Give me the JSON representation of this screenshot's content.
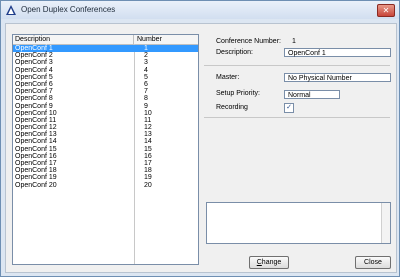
{
  "window": {
    "title": "Open Duplex Conferences",
    "close_glyph": "✕"
  },
  "list": {
    "columns": {
      "description": "Description",
      "number": "Number"
    },
    "rows": [
      {
        "description": "OpenConf 1",
        "number": "1"
      },
      {
        "description": "OpenConf 2",
        "number": "2"
      },
      {
        "description": "OpenConf 3",
        "number": "3"
      },
      {
        "description": "OpenConf 4",
        "number": "4"
      },
      {
        "description": "OpenConf 5",
        "number": "5"
      },
      {
        "description": "OpenConf 6",
        "number": "6"
      },
      {
        "description": "OpenConf 7",
        "number": "7"
      },
      {
        "description": "OpenConf 8",
        "number": "8"
      },
      {
        "description": "OpenConf 9",
        "number": "9"
      },
      {
        "description": "OpenConf 10",
        "number": "10"
      },
      {
        "description": "OpenConf 11",
        "number": "11"
      },
      {
        "description": "OpenConf 12",
        "number": "12"
      },
      {
        "description": "OpenConf 13",
        "number": "13"
      },
      {
        "description": "OpenConf 14",
        "number": "14"
      },
      {
        "description": "OpenConf 15",
        "number": "15"
      },
      {
        "description": "OpenConf 16",
        "number": "16"
      },
      {
        "description": "OpenConf 17",
        "number": "17"
      },
      {
        "description": "OpenConf 18",
        "number": "18"
      },
      {
        "description": "OpenConf 19",
        "number": "19"
      },
      {
        "description": "OpenConf 20",
        "number": "20"
      }
    ],
    "selected_index": 0
  },
  "details": {
    "conference_number_label": "Conference Number:",
    "conference_number_value": "1",
    "description_label": "Description:",
    "description_value": "OpenConf 1",
    "master_label": "Master:",
    "master_value": "No Physical Number",
    "setup_priority_label": "Setup Priority:",
    "setup_priority_value": "Normal",
    "recording_label": "Recording",
    "recording_checked": true,
    "check_glyph": "✓"
  },
  "buttons": {
    "change_first": "C",
    "change_rest": "hange",
    "close": "Close"
  },
  "colors": {
    "selection": "#3399ff",
    "window_frame": "#dce6f2"
  }
}
